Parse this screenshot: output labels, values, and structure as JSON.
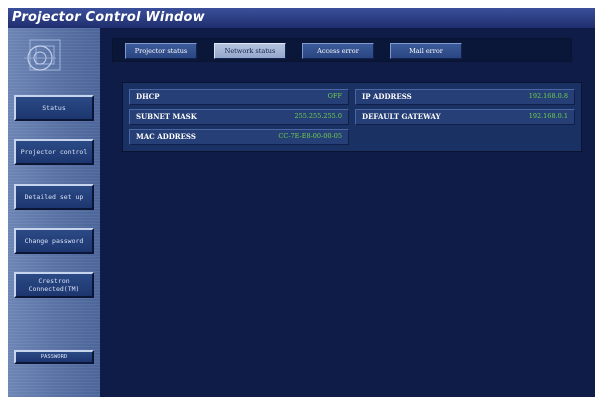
{
  "window": {
    "title": "Projector Control Window"
  },
  "sidebar": {
    "items": [
      {
        "label": "Status"
      },
      {
        "label": "Projector control"
      },
      {
        "label": "Detailed set up"
      },
      {
        "label": "Change password"
      },
      {
        "label": "Crestron Connected(TM)"
      }
    ],
    "password_button": "PASSWORD"
  },
  "tabs": [
    {
      "label": "Projector status",
      "active": false
    },
    {
      "label": "Network status",
      "active": true
    },
    {
      "label": "Access error",
      "active": false
    },
    {
      "label": "Mail error",
      "active": false
    }
  ],
  "network_status": {
    "dhcp": {
      "label": "DHCP",
      "value": "OFF"
    },
    "subnet_mask": {
      "label": "SUBNET MASK",
      "value": "255.255.255.0"
    },
    "mac_address": {
      "label": "MAC ADDRESS",
      "value": "CC-7E-E8-00-00-05"
    },
    "ip_address": {
      "label": "IP ADDRESS",
      "value": "192.168.0.8"
    },
    "default_gateway": {
      "label": "DEFAULT GATEWAY",
      "value": "192.168.0.1"
    }
  },
  "colors": {
    "title_bar": "#1f2e6e",
    "background": "#0e1c47",
    "sidebar": "#5a73a5",
    "value_text": "#6fd14a"
  }
}
